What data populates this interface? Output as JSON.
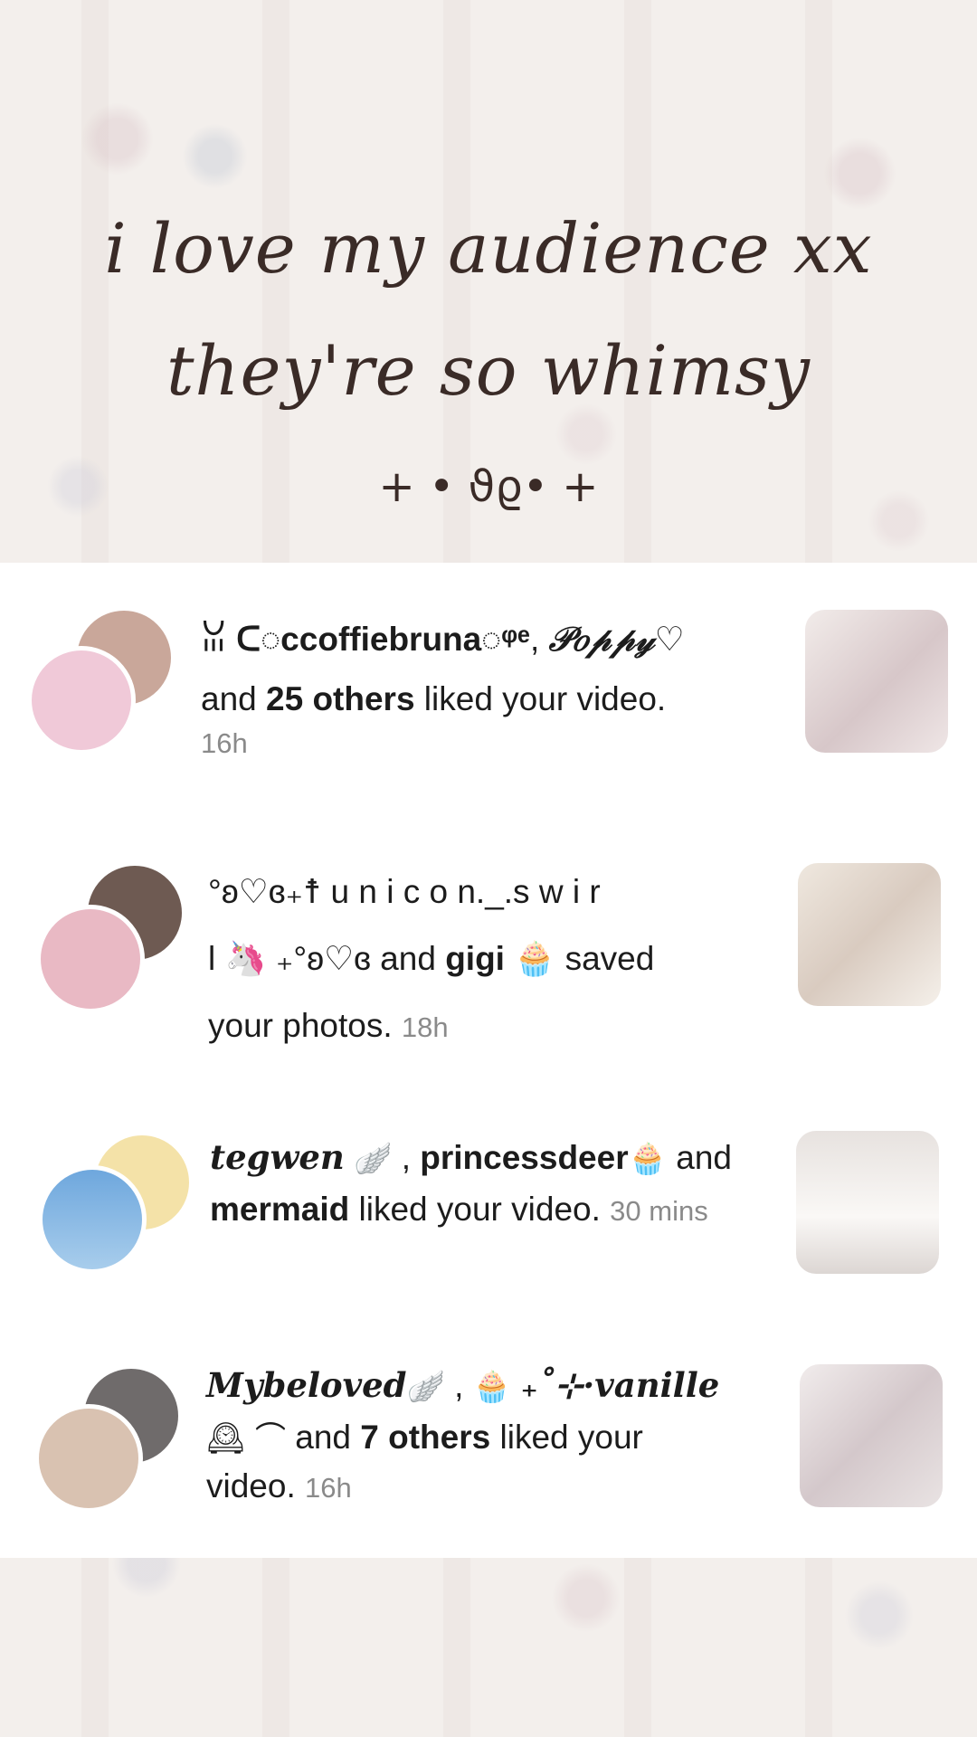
{
  "header": {
    "line1": "i love my audience xx",
    "line2": "they're so whimsy",
    "decoration": "+ • ϑϱ• +"
  },
  "notifications": [
    {
      "names_a": "ꈍ ᑕ◌ccoffiebruna◌ᵠᵉ",
      "names_b": "𝒫𝑜𝓅𝓅𝓎♡",
      "rest_pre": "and ",
      "rest_bold": "25 others",
      "rest_post": " liked your video.",
      "time": "16h",
      "colors": {
        "av_back": "#c9a79a",
        "av_front": "#f0c9d8",
        "thumb": "#e8dcdc"
      }
    },
    {
      "line1": "°ʚ♡ɞ₊☨ u n i c o n._.s w i r",
      "line2_a": "l 🦄 ₊°ʚ♡ɞ and ",
      "line2_bold": "gigi",
      "line2_b": " 🧁 saved",
      "line3": "your photos.",
      "time": "18h",
      "colors": {
        "av_back": "#6e5a52",
        "av_front": "#e9b9c4",
        "thumb": "#eae3da"
      }
    },
    {
      "name_a": "tegwen",
      "icon_a": "🪽",
      "sep": " , ",
      "name_b": "princessdeer",
      "icon_b": "🧁",
      "and": " and",
      "name_c": "mermaid",
      "rest": " liked your video.",
      "time": "30 mins",
      "colors": {
        "av_back": "#f4e2a8",
        "av_front": "#7fb3de",
        "thumb": "#efebe8"
      }
    },
    {
      "name_a": "Mybeloved",
      "icon_a": "🪽",
      "sep": " , ",
      "icon_b": "🧁",
      "name_b": "₊˚⊹·vanille",
      "line2_icons": "🕰 ⌒",
      "rest_pre": " and ",
      "rest_bold": "7 others",
      "rest_post": " liked your",
      "line3": "video.",
      "time": "16h",
      "colors": {
        "av_back": "#6f6b6b",
        "av_front": "#d9c2b1",
        "thumb": "#ddd4d4"
      }
    }
  ]
}
